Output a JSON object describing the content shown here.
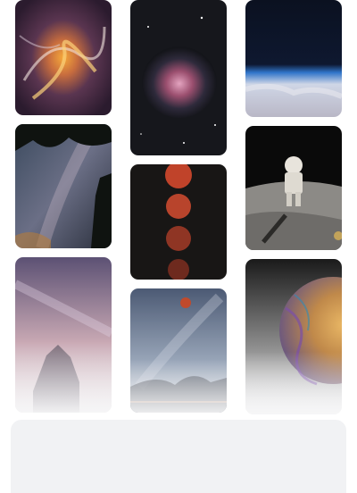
{
  "gallery": {
    "tiles": [
      {
        "subject": "nebula-swirl"
      },
      {
        "subject": "orion-nebula"
      },
      {
        "subject": "earth-horizon"
      },
      {
        "subject": "milky-way-trees"
      },
      {
        "subject": "lunar-eclipse-phases"
      },
      {
        "subject": "astronaut-on-moon"
      },
      {
        "subject": "milky-way-over-house"
      },
      {
        "subject": "blood-moon-milky-way"
      },
      {
        "subject": "soap-bubble-planet"
      }
    ]
  },
  "colors": {
    "background": "#ffffff",
    "panel": "#f1f2f4"
  }
}
